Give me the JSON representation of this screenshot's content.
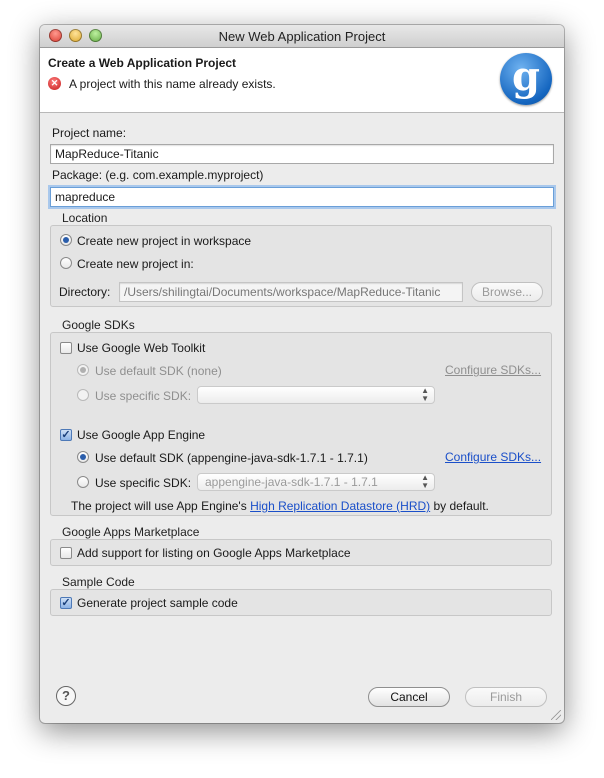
{
  "window": {
    "title": "New Web Application Project"
  },
  "banner": {
    "title": "Create a Web Application Project",
    "error_message": "A project with this name already exists.",
    "logo_glyph": "g"
  },
  "form": {
    "project_name_label": "Project name:",
    "project_name_value": "MapReduce-Titanic",
    "package_label": "Package: (e.g. com.example.myproject)",
    "package_value": "mapreduce"
  },
  "location": {
    "title": "Location",
    "option_workspace": "Create new project in workspace",
    "option_in": "Create new project in:",
    "directory_label": "Directory:",
    "directory_value": "/Users/shilingtai/Documents/workspace/MapReduce-Titanic",
    "browse_label": "Browse...",
    "selected": "workspace"
  },
  "google_sdks": {
    "title": "Google SDKs",
    "gwt": {
      "checkbox_label": "Use Google Web Toolkit",
      "checked": false,
      "default_sdk_label": "Use default SDK (none)",
      "specific_sdk_label": "Use specific SDK:",
      "specific_sdk_value": "",
      "configure_label": "Configure SDKs..."
    },
    "app_engine": {
      "checkbox_label": "Use Google App Engine",
      "checked": true,
      "default_sdk_label": "Use default SDK (appengine-java-sdk-1.7.1 - 1.7.1)",
      "specific_sdk_label": "Use specific SDK:",
      "specific_sdk_value": "appengine-java-sdk-1.7.1 - 1.7.1",
      "configure_label": "Configure SDKs...",
      "note_prefix": "The project will use App Engine's",
      "note_link": "High Replication Datastore (HRD)",
      "note_suffix": "by default."
    }
  },
  "marketplace": {
    "title": "Google Apps Marketplace",
    "checkbox_label": "Add support for listing on Google Apps Marketplace",
    "checked": false
  },
  "sample_code": {
    "title": "Sample Code",
    "checkbox_label": "Generate project sample code",
    "checked": true
  },
  "footer": {
    "help_glyph": "?",
    "cancel_label": "Cancel",
    "finish_label": "Finish"
  },
  "colors": {
    "accent": "#2a5dab",
    "link": "#1a4fc9",
    "error": "#c41a1a"
  }
}
